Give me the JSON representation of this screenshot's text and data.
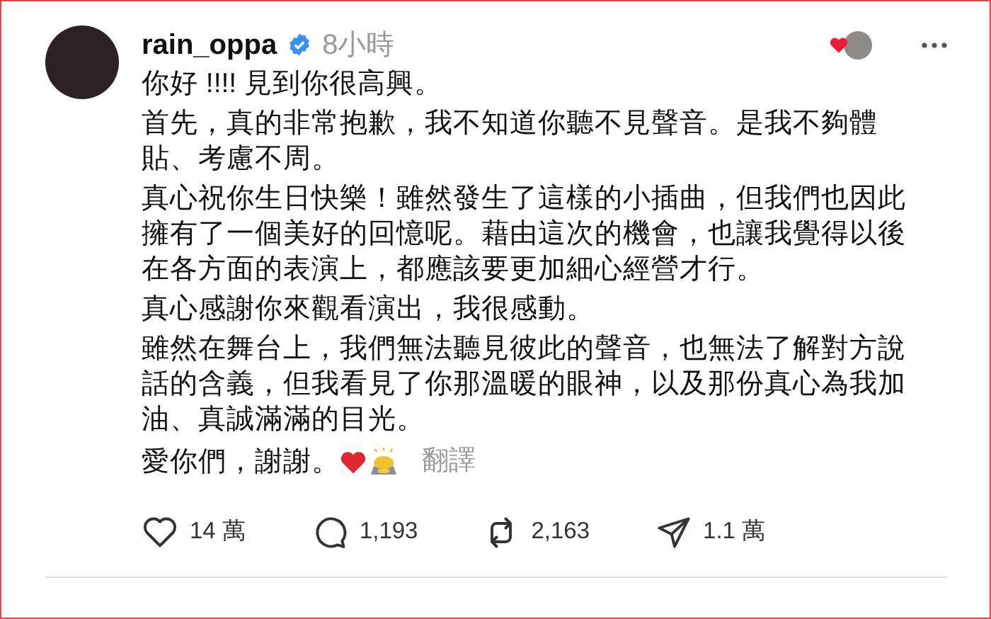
{
  "post": {
    "username": "rain_oppa",
    "verified": true,
    "time": "8小時",
    "paragraphs": [
      "你好 !!!! 見到你很高興。",
      "首先，真的非常抱歉，我不知道你聽不見聲音。是我不夠體貼、考慮不周。",
      "真心祝你生日快樂！雖然發生了這樣的小插曲，但我們也因此擁有了一個美好的回憶呢。藉由這次的機會，也讓我覺得以後在各方面的表演上，都應該要更加細心經營才行。",
      "真心感謝你來觀看演出，我很感動。",
      "雖然在舞台上，我們無法聽見彼此的聲音，也無法了解對方說話的含義，但我看見了你那溫暖的眼神，以及那份真心為我加油、真誠滿滿的目光。"
    ],
    "closing": "愛你們，謝謝。",
    "translate": "翻譯",
    "actions": [
      {
        "kind": "like",
        "count": "14 萬"
      },
      {
        "kind": "comment",
        "count": "1,193"
      },
      {
        "kind": "repost",
        "count": "2,163"
      },
      {
        "kind": "share",
        "count": "1.1 萬"
      }
    ]
  }
}
